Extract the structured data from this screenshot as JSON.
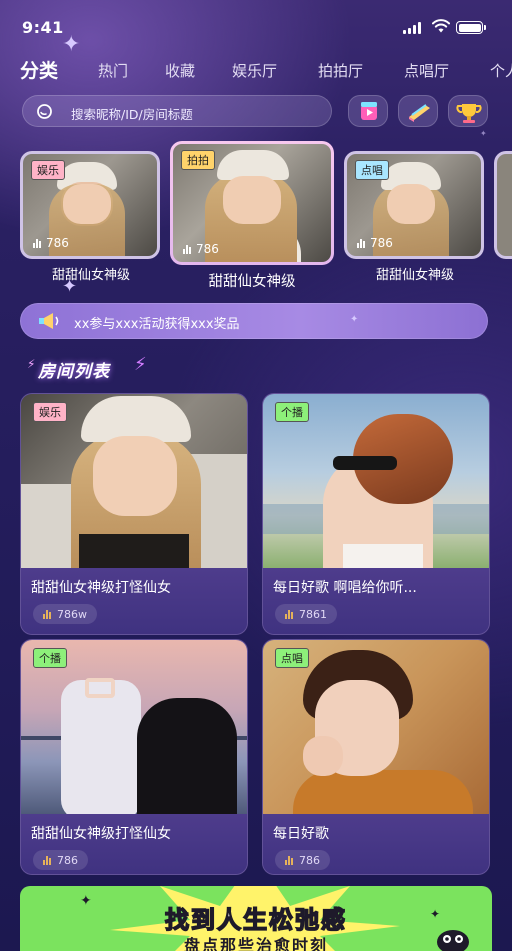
{
  "status_bar": {
    "time": "9:41"
  },
  "tabs": [
    {
      "label": "分类",
      "active": true
    },
    {
      "label": "热门"
    },
    {
      "label": "收藏"
    },
    {
      "label": "娱乐厅"
    },
    {
      "label": "拍拍厅"
    },
    {
      "label": "点唱厅"
    },
    {
      "label": "个人"
    }
  ],
  "search": {
    "placeholder": "搜索昵称/ID/房间标题"
  },
  "featured": [
    {
      "tag": "娱乐",
      "count": "786",
      "title": "甜甜仙女神级",
      "tag_color": "#ffb3c7"
    },
    {
      "tag": "拍拍",
      "count": "786",
      "title": "甜甜仙女神级",
      "tag_color": "#ffd36b"
    },
    {
      "tag": "点唱",
      "count": "786",
      "title": "甜甜仙女神级",
      "tag_color": "#a9e6ff"
    }
  ],
  "notice": {
    "text": "xx参与xxx活动获得xxx奖品"
  },
  "section": {
    "title": "房间列表"
  },
  "rooms": [
    {
      "tag": "娱乐",
      "tag_color": "#ffb3c7",
      "title": "甜甜仙女神级打怪仙女",
      "count": "786w"
    },
    {
      "tag": "个播",
      "tag_color": "#8df07a",
      "title": "每日好歌   啊唱给你听...",
      "count": "7861"
    },
    {
      "tag": "个播",
      "tag_color": "#8df07a",
      "title": "甜甜仙女神级打怪仙女",
      "count": "786"
    },
    {
      "tag": "点唱",
      "tag_color": "#8df07a",
      "title": "每日好歌",
      "count": "786"
    }
  ],
  "banner": {
    "line1": "找到人生松弛感",
    "line2": "盘点那些治愈时刻"
  },
  "colors": {
    "accent": "#a78ae4",
    "bg": "#241d5c"
  }
}
